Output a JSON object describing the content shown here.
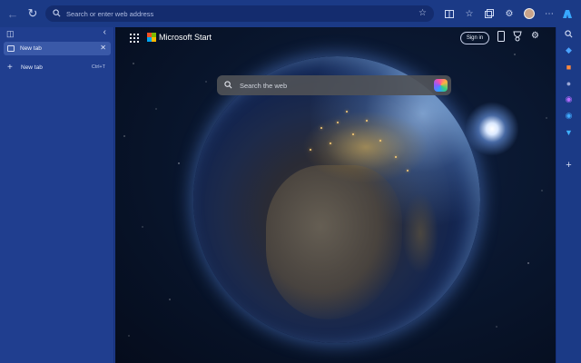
{
  "toolbar": {
    "address_placeholder": "Search or enter web address"
  },
  "tabs_panel": {
    "tabs": [
      {
        "label": "New tab",
        "active": true
      }
    ],
    "new_tab_label": "New tab",
    "new_tab_shortcut": "Ctrl+T"
  },
  "new_tab_page": {
    "brand": "Microsoft Start",
    "sign_in_label": "Sign in",
    "search_placeholder": "Search the web"
  },
  "colors": {
    "chrome_bg": "#1b3a86",
    "tab_panel_bg": "#203e8f",
    "active_tab_bg": "#3a59a8",
    "ms_red": "#f25022",
    "ms_green": "#7fba00",
    "ms_blue": "#00a4ef",
    "ms_yellow": "#ffb900"
  },
  "icons": {
    "back": "back-arrow-icon",
    "refresh": "refresh-icon",
    "search": "search-icon",
    "favorite": "star-icon",
    "split_screen": "split-screen-icon",
    "favorites": "favorites-icon",
    "collections": "collections-icon",
    "extensions": "extensions-icon",
    "more": "more-icon",
    "copilot": "copilot-icon"
  }
}
